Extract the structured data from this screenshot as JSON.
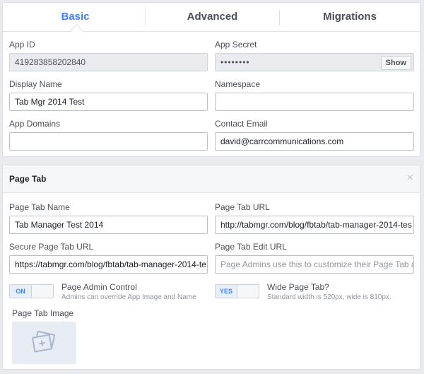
{
  "tabs": [
    {
      "label": "Basic",
      "active": true
    },
    {
      "label": "Advanced",
      "active": false
    },
    {
      "label": "Migrations",
      "active": false
    }
  ],
  "basic": {
    "app_id_label": "App ID",
    "app_id_value": "419283858202840",
    "app_secret_label": "App Secret",
    "app_secret_value": "••••••••",
    "show_label": "Show",
    "display_name_label": "Display Name",
    "display_name_value": "Tab Mgr 2014 Test",
    "namespace_label": "Namespace",
    "namespace_value": "",
    "app_domains_label": "App Domains",
    "app_domains_value": "",
    "contact_email_label": "Contact Email",
    "contact_email_value": "david@carrcommunications.com"
  },
  "page_tab": {
    "title": "Page Tab",
    "close": "×",
    "name_label": "Page Tab Name",
    "name_value": "Tab Manager Test 2014",
    "url_label": "Page Tab URL",
    "url_value": "http://tabmgr.com/blog/fbtab/tab-manager-2014-tes",
    "secure_url_label": "Secure Page Tab URL",
    "secure_url_value": "https://tabmgr.com/blog/fbtab/tab-manager-2014-te",
    "edit_url_label": "Page Tab Edit URL",
    "edit_url_placeholder": "Page Admins use this to customize their Page Tab a",
    "admin_control_toggle": "ON",
    "admin_control_title": "Page Admin Control",
    "admin_control_desc": "Admins can override App Image and Name",
    "wide_toggle": "YES",
    "wide_title": "Wide Page Tab?",
    "wide_desc": "Standard width is 520px, wide is 810px.",
    "image_label": "Page Tab Image"
  },
  "colors": {
    "accent": "#4080ff",
    "background": "#e9ebee"
  },
  "icons": {
    "image_placeholder": "image-placeholder-icon",
    "close": "close-icon"
  }
}
